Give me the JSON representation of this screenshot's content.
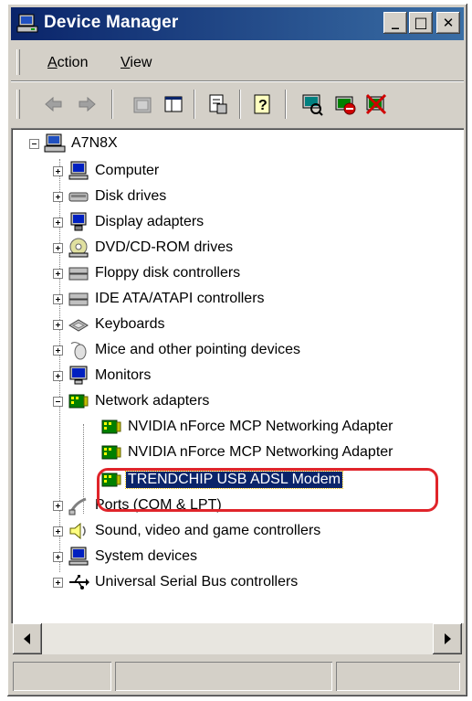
{
  "window": {
    "title": "Device Manager"
  },
  "titlebar_buttons": {
    "minimize": "_",
    "maximize": "□",
    "close": "✕"
  },
  "menu": [
    "Action",
    "View"
  ],
  "menu_access_keys": [
    "A",
    "V"
  ],
  "toolbar": {
    "icons": [
      "back-arrow-icon",
      "forward-arrow-icon",
      "up-folder-icon",
      "show-hide-tree-icon",
      "properties-icon",
      "help-icon",
      "scan-hardware-icon",
      "uninstall-icon",
      "disable-icon"
    ]
  },
  "tree": {
    "root": {
      "label": "A7N8X",
      "icon": "computer-icon"
    },
    "categories": [
      {
        "label": "Computer",
        "icon": "computer-icon",
        "expanded": false
      },
      {
        "label": "Disk drives",
        "icon": "disk-drive-icon",
        "expanded": false
      },
      {
        "label": "Display adapters",
        "icon": "display-adapter-icon",
        "expanded": false
      },
      {
        "label": "DVD/CD-ROM drives",
        "icon": "cdrom-icon",
        "expanded": false
      },
      {
        "label": "Floppy disk controllers",
        "icon": "floppy-controller-icon",
        "expanded": false
      },
      {
        "label": "IDE ATA/ATAPI controllers",
        "icon": "ide-controller-icon",
        "expanded": false
      },
      {
        "label": "Keyboards",
        "icon": "keyboard-icon",
        "expanded": false
      },
      {
        "label": "Mice and other pointing devices",
        "icon": "mouse-icon",
        "expanded": false
      },
      {
        "label": "Monitors",
        "icon": "monitor-icon",
        "expanded": false
      },
      {
        "label": "Network adapters",
        "icon": "network-adapter-icon",
        "expanded": true
      },
      {
        "label": "Ports (COM & LPT)",
        "icon": "port-icon",
        "expanded": false
      },
      {
        "label": "Sound, video and game controllers",
        "icon": "sound-icon",
        "expanded": false
      },
      {
        "label": "System devices",
        "icon": "system-devices-icon",
        "expanded": false
      },
      {
        "label": "Universal Serial Bus controllers",
        "icon": "usb-icon",
        "expanded": false
      }
    ],
    "network_children": [
      {
        "label": "NVIDIA nForce MCP Networking Adapter",
        "icon": "network-adapter-icon",
        "selected": false
      },
      {
        "label": "NVIDIA nForce MCP Networking Adapter",
        "icon": "network-adapter-icon",
        "selected": false
      },
      {
        "label": "TRENDCHIP USB ADSL Modem",
        "icon": "network-adapter-icon",
        "selected": true
      }
    ]
  },
  "colors": {
    "selection": "#0a246a",
    "highlight_ring": "#e0242a",
    "titlebar_start": "#0a246a",
    "titlebar_end": "#3a6ea5"
  }
}
